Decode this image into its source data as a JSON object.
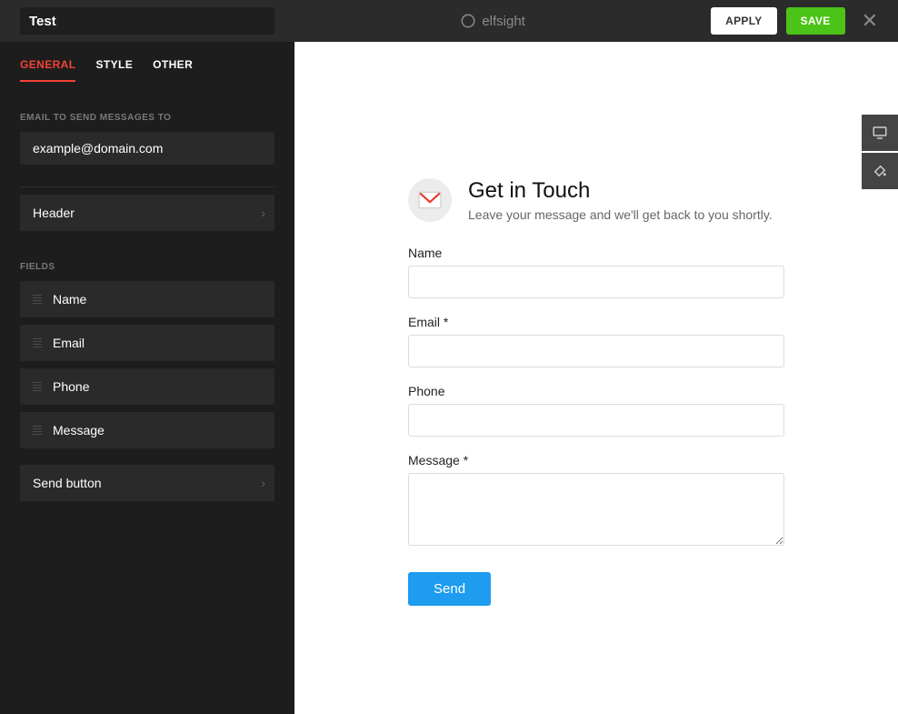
{
  "topbar": {
    "title_value": "Test",
    "brand": "elfsight",
    "apply_label": "APPLY",
    "save_label": "SAVE"
  },
  "sidebar": {
    "tabs": [
      {
        "label": "GENERAL",
        "active": true
      },
      {
        "label": "STYLE",
        "active": false
      },
      {
        "label": "OTHER",
        "active": false
      }
    ],
    "email_section_label": "EMAIL TO SEND MESSAGES TO",
    "email_value": "example@domain.com",
    "header_item": "Header",
    "fields_section_label": "FIELDS",
    "fields": [
      {
        "label": "Name"
      },
      {
        "label": "Email"
      },
      {
        "label": "Phone"
      },
      {
        "label": "Message"
      }
    ],
    "send_button_item": "Send button"
  },
  "form": {
    "title": "Get in Touch",
    "subtitle": "Leave your message and we'll get back to you shortly.",
    "fields": {
      "name": {
        "label": "Name"
      },
      "email": {
        "label": "Email *"
      },
      "phone": {
        "label": "Phone"
      },
      "message": {
        "label": "Message *"
      }
    },
    "send_label": "Send"
  },
  "colors": {
    "accent_red": "#f44336",
    "save_green": "#4cc317",
    "send_blue": "#1e9cf0"
  }
}
